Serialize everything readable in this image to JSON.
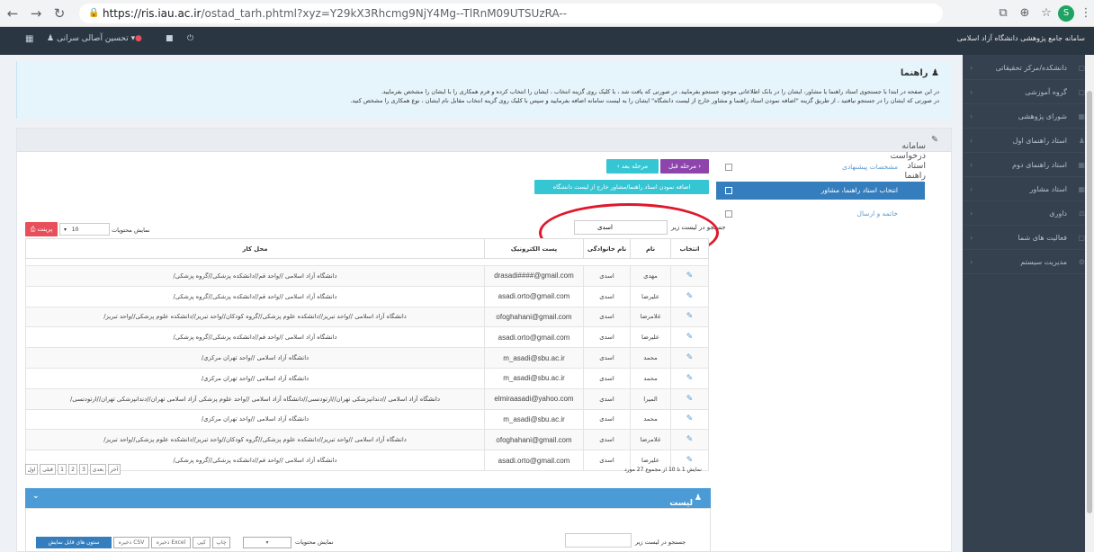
{
  "browser": {
    "url_host": "https://ris.iau.ac.ir",
    "url_path": "/ostad_tarh.phtml?xyz=Y29kX3Rhcmg9NjY4Mg--TlRnM09UTSUzRA--",
    "icons": [
      "back-icon",
      "forward-icon",
      "reload-icon",
      "lock-icon",
      "translate-icon",
      "zoom-icon",
      "star-icon",
      "extension-icon",
      "menu-icon"
    ]
  },
  "topbar": {
    "user": "تحسین آصالی سرانی",
    "site_title": "سامانه جامع پژوهشی دانشگاه آزاد اسلامی"
  },
  "sidebar": {
    "items": [
      {
        "label": "دانشکده/مرکز تحقیقاتی"
      },
      {
        "label": "گروه آموزشی"
      },
      {
        "label": "شورای پژوهشی"
      },
      {
        "label": "استاد راهنمای اول"
      },
      {
        "label": "استاد راهنمای دوم"
      },
      {
        "label": "استاد مشاور"
      },
      {
        "label": "داوری"
      },
      {
        "label": "فعالیت های شما"
      },
      {
        "label": "مدیریت سیستم"
      }
    ]
  },
  "guide": {
    "title": "راهنما",
    "line1": "در این صفحه در ابتدا با جستجوی استاد راهنما یا مشاور، ایشان را در بانک اطلاعاتی موجود جستجو بفرمایید. در صورتی که یافت شد ، با کلیک روی گزینه انتخاب ، ایشان را انتخاب کرده و فرم همکاری را با ایشان را مشخص بفرمایید.",
    "line2": "در صورتی که ایشان را در جستجو نیافتید ، از طریق گزینه \"اضافه نمودن استاد راهنما و مشاور خارج از لیست دانشگاه\" ایشان را به لیست سامانه اضافه بفرمایید و سپس با کلیک روی گزینه انتخاب مقابل نام ایشان ، نوع همکاری را مشخص کنید."
  },
  "panel": {
    "title": "سامانه درخواست استاد راهنما",
    "steps": [
      {
        "label": "مشخصات پیشنهادی"
      },
      {
        "label": "انتخاب استاد راهنما، مشاور"
      },
      {
        "label": "خاتمه و ارسال"
      }
    ],
    "prev_step": "مرحله قبل",
    "next_step": "مرحله بعد",
    "add_external": "اضافه نمودن استاد راهنما/مشاور خارج از لیست دانشگاه",
    "search_label": "جستجو در لیست زیر",
    "search_value": "اسدی",
    "show_label": "نمایش محتویات",
    "page_size": "10",
    "print_label": "پرینت",
    "columns": [
      "انتخاب",
      "نام",
      "نام خانوادگی",
      "پست الکترونیک",
      "محل کار"
    ],
    "rows": [
      [
        "مهدی",
        "اسدی",
        "drasadi####@gmail.com",
        "دانشگاه آزاد اسلامی //واحد قم//دانشکده پزشکی//گروه پزشکی/"
      ],
      [
        "علیرضا",
        "اسدی",
        "asadi.orto@gmail.com",
        "دانشگاه آزاد اسلامی //واحد قم//دانشکده پزشکی//گروه پزشکی/"
      ],
      [
        "غلامرضا",
        "اسدی",
        "ofoghahani@gmail.com",
        "دانشگاه آزاد اسلامی //واحد تبریز//دانشکده علوم پزشکی//گروه کودکان//واحد تبریز//دانشکده علوم پزشکی//واحد تبریز/"
      ],
      [
        "علیرضا",
        "اسدی",
        "asadi.orto@gmail.com",
        "دانشگاه آزاد اسلامی //واحد قم//دانشکده پزشکی//گروه پزشکی/"
      ],
      [
        "محمد",
        "اسدی",
        "m_asadi@sbu.ac.ir",
        "دانشگاه آزاد اسلامی //واحد تهران مرکزی/"
      ],
      [
        "محمد",
        "اسدی",
        "m_asadi@sbu.ac.ir",
        "دانشگاه آزاد اسلامی //واحد تهران مرکزی/"
      ],
      [
        "المیرا",
        "اسدی",
        "elmiraasadi@yahoo.com",
        "دانشگاه آزاد اسلامی //دندانپزشکی تهران//ارتودنسی//دانشگاه آزاد اسلامی //واحد علوم پزشکی آزاد اسلامی تهران//دندانپزشکی تهران//ارتودنسی/"
      ],
      [
        "محمد",
        "اسدی",
        "m_asadi@sbu.ac.ir",
        "دانشگاه آزاد اسلامی //واحد تهران مرکزی/"
      ],
      [
        "غلامرضا",
        "اسدی",
        "ofoghahani@gmail.com",
        "دانشگاه آزاد اسلامی //واحد تبریز//دانشکده علوم پزشکی//گروه کودکان//واحد تبریز//دانشکده علوم پزشکی//واحد تبریز/"
      ],
      [
        "علیرضا",
        "اسدی",
        "asadi.orto@gmail.com",
        "دانشگاه آزاد اسلامی //واحد قم//دانشکده پزشکی//گروه پزشکی/"
      ]
    ],
    "info": "نمایش 1 تا 10 از مجموع 27 مورد",
    "pagination": [
      "اول",
      "قبلی",
      "1",
      "2",
      "3",
      "بعدی",
      "آخر"
    ],
    "selected_title": "لیست اساتید انتخابی",
    "export_buttons": [
      "ذخیره Excel",
      "ذخیره CSV",
      "ستون های قابل نمایش",
      "کپی",
      "چاپ"
    ]
  }
}
